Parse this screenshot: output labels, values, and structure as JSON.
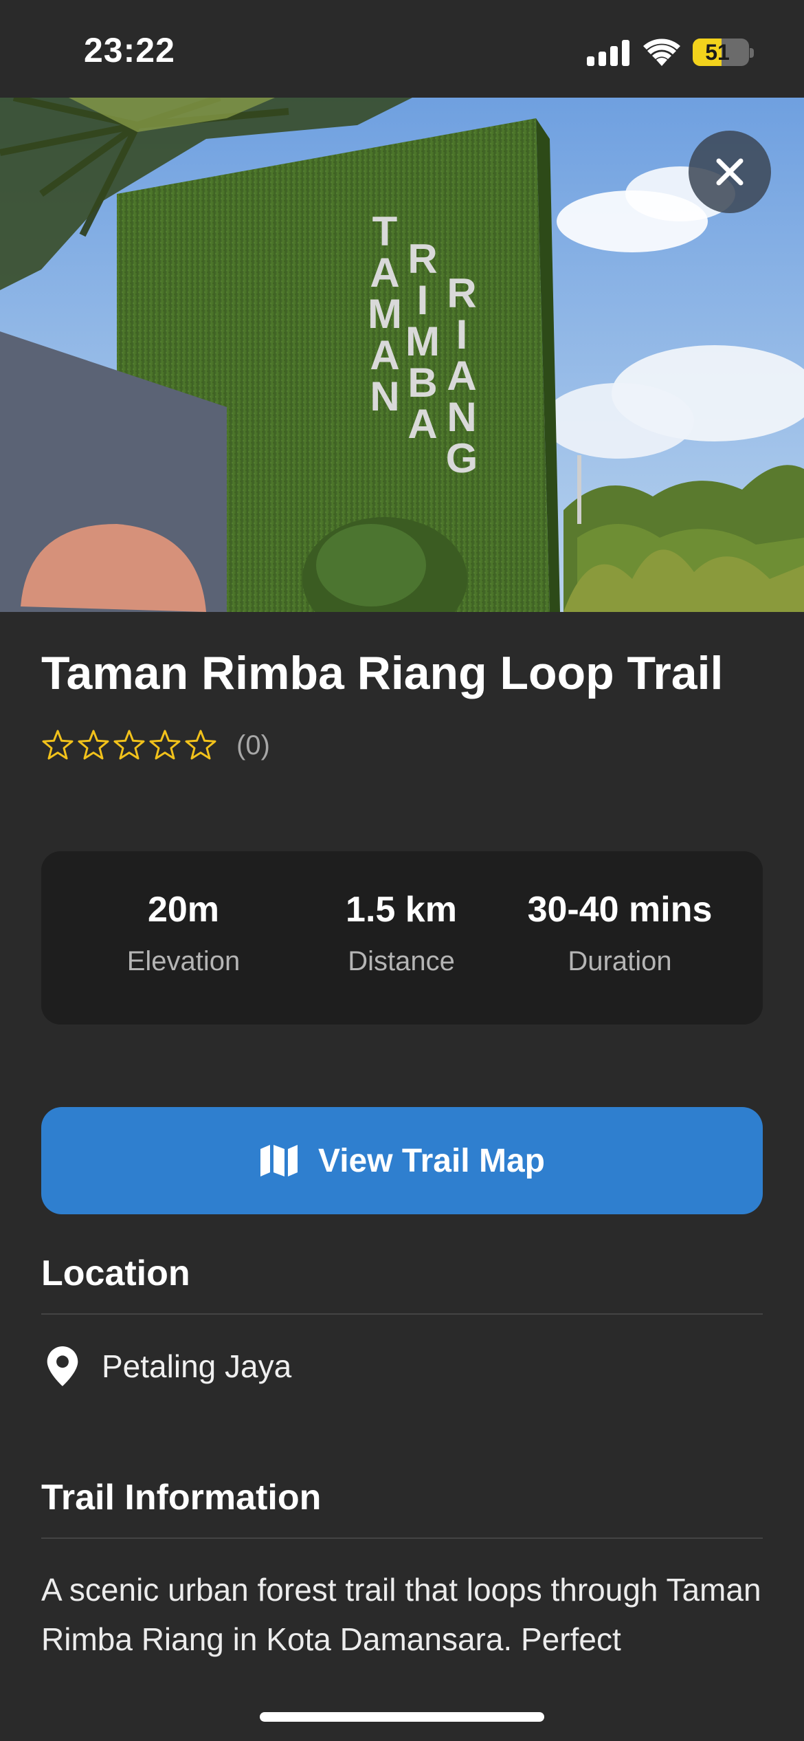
{
  "status_bar": {
    "time": "23:22",
    "battery_level": "51",
    "battery_percent": 51
  },
  "hero": {
    "sign_words": [
      "TAMAN",
      "RIMBA",
      "RIANG"
    ],
    "close_icon": "close-icon"
  },
  "trail": {
    "title": "Taman Rimba Riang Loop Trail",
    "rating_stars": 0,
    "rating_max": 5,
    "review_count": "(0)"
  },
  "stats": [
    {
      "value": "20m",
      "label": "Elevation"
    },
    {
      "value": "1.5 km",
      "label": "Distance"
    },
    {
      "value": "30-40 mins",
      "label": "Duration"
    }
  ],
  "map_button": {
    "label": "View Trail Map",
    "icon": "map-icon"
  },
  "location": {
    "heading": "Location",
    "place": "Petaling Jaya",
    "icon": "location-pin-icon"
  },
  "trail_info": {
    "heading": "Trail Information",
    "description": "A scenic urban forest trail that loops through Taman Rimba Riang in Kota Damansara. Perfect"
  },
  "colors": {
    "background": "#2a2a2a",
    "card": "#1e1e1e",
    "accent_blue": "#2f7fcf",
    "star_yellow": "#f2c21b",
    "battery_yellow": "#f2d21c"
  }
}
